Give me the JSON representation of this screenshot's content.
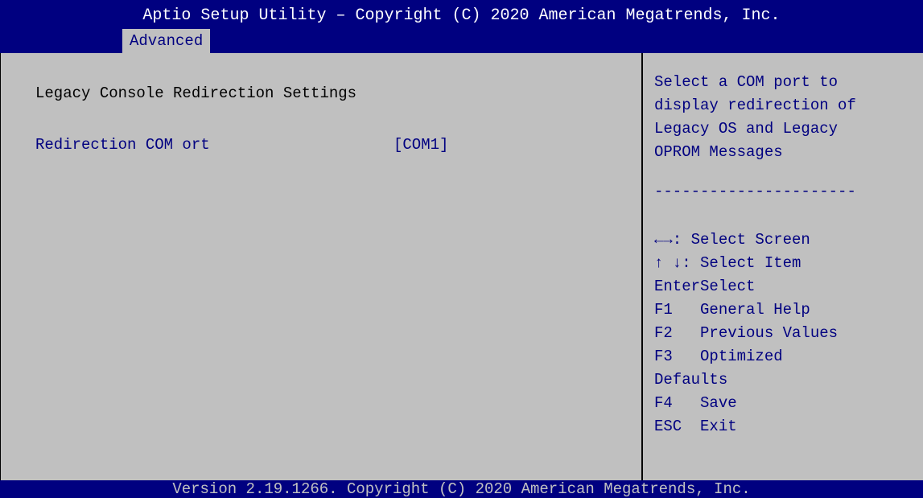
{
  "header": {
    "title": "Aptio Setup Utility – Copyright (C) 2020 American Megatrends, Inc.",
    "tab": "Advanced"
  },
  "main": {
    "section_title": "Legacy Console Redirection Settings",
    "item_label": "Redirection COM ort",
    "item_value": "[COM1]"
  },
  "help": {
    "lines": [
      "Select a COM port to",
      "display redirection of",
      "Legacy OS and Legacy",
      "OPROM Messages"
    ],
    "separator": "----------------------",
    "keys": [
      "←→: Select Screen",
      "↑ ↓: Select Item",
      "EnterSelect",
      "F1   General Help",
      "F2   Previous Values",
      "F3   Optimized",
      "Defaults",
      "F4   Save",
      "ESC  Exit"
    ]
  },
  "footer": {
    "version": "Version 2.19.1266. Copyright (C) 2020 American Megatrends, Inc."
  },
  "colors": {
    "background": "#c0c0c0",
    "bar": "#000080",
    "accent_text": "#000080"
  }
}
